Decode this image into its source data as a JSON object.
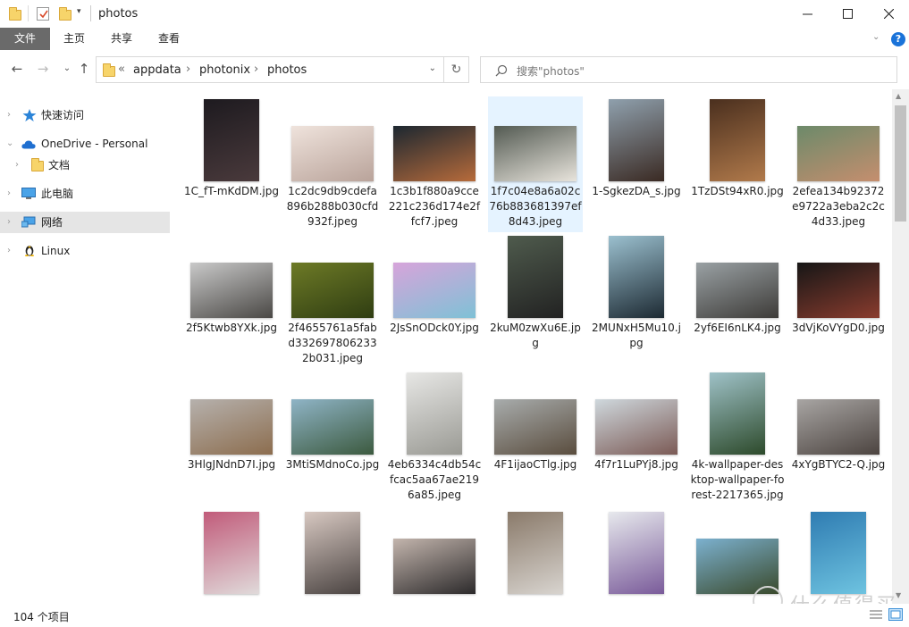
{
  "window": {
    "title": "photos"
  },
  "ribbon": {
    "tabs": [
      "文件",
      "主页",
      "共享",
      "查看"
    ]
  },
  "address": {
    "overflow": "«",
    "parts": [
      "appdata",
      "photonix",
      "photos"
    ],
    "separator": "›"
  },
  "search": {
    "placeholder": "搜索\"photos\""
  },
  "sidebar": {
    "items": [
      {
        "label": "快速访问",
        "icon": "star-icon"
      },
      {
        "label": "OneDrive - Personal",
        "icon": "cloud-icon"
      },
      {
        "label": "文档",
        "icon": "folder-icon"
      },
      {
        "label": "此电脑",
        "icon": "computer-icon"
      },
      {
        "label": "网络",
        "icon": "network-icon"
      },
      {
        "label": "Linux",
        "icon": "linux-icon"
      }
    ]
  },
  "files": [
    {
      "name": "1C_fT-mKdDM.jpg",
      "c1": "#1d1a1f",
      "c2": "#4a3a3c"
    },
    {
      "name": "1c2dc9db9cdefa896b288b030cfd932f.jpeg",
      "c1": "#efe3dc",
      "c2": "#b9a39a"
    },
    {
      "name": "1c3b1f880a9cce221c236d174e2ffcf7.jpeg",
      "c1": "#1c2730",
      "c2": "#b76b3b"
    },
    {
      "name": "1f7c04e8a6a02c76b883681397ef8d43.jpeg",
      "c1": "#535a52",
      "c2": "#e8e4dc"
    },
    {
      "name": "1-SgkezDA_s.jpg",
      "c1": "#8fa0ad",
      "c2": "#3a2a23"
    },
    {
      "name": "1TzDSt94xR0.jpg",
      "c1": "#4a2f1e",
      "c2": "#b17a4b"
    },
    {
      "name": "2efea134b92372e9722a3eba2c2c4d33.jpeg",
      "c1": "#6c8a6a",
      "c2": "#c58e6e"
    },
    {
      "name": "2f5Ktwb8YXk.jpg",
      "c1": "#c9c9c9",
      "c2": "#4a4845"
    },
    {
      "name": "2f4655761a5fabd3326978062332b031.jpeg",
      "c1": "#6d7a26",
      "c2": "#2f3d12"
    },
    {
      "name": "2JsSnODck0Y.jpg",
      "c1": "#d7a4da",
      "c2": "#7fc1d6"
    },
    {
      "name": "2kuM0zwXu6E.jpg",
      "c1": "#4f5b4d",
      "c2": "#222"
    },
    {
      "name": "2MUNxH5Mu10.jpg",
      "c1": "#9bc0cf",
      "c2": "#1d2a33"
    },
    {
      "name": "2yf6EI6nLK4.jpg",
      "c1": "#9aa1a4",
      "c2": "#3d3b38"
    },
    {
      "name": "3dVjKoVYgD0.jpg",
      "c1": "#161616",
      "c2": "#8a3c2e"
    },
    {
      "name": "3HlgJNdnD7I.jpg",
      "c1": "#b6b1ad",
      "c2": "#8c6d4e"
    },
    {
      "name": "3MtiSMdnoCo.jpg",
      "c1": "#8fb4c6",
      "c2": "#3c5a3f"
    },
    {
      "name": "4eb6334c4db54cfcac5aa67ae2196a85.jpeg",
      "c1": "#e7e7e5",
      "c2": "#9a9a94"
    },
    {
      "name": "4F1ijaoCTlg.jpg",
      "c1": "#a8acac",
      "c2": "#5a4d3e"
    },
    {
      "name": "4f7r1LuPYj8.jpg",
      "c1": "#cfd8dd",
      "c2": "#7b5a55"
    },
    {
      "name": "4k-wallpaper-desktop-wallpaper-forest-2217365.jpg",
      "c1": "#9fc2c8",
      "c2": "#2d4a2b"
    },
    {
      "name": "4xYgBTYC2-Q.jpg",
      "c1": "#a8a5a3",
      "c2": "#4c4440"
    },
    {
      "name": "",
      "c1": "#c15b7a",
      "c2": "#e0dada"
    },
    {
      "name": "",
      "c1": "#d7c8c1",
      "c2": "#4b4442"
    },
    {
      "name": "",
      "c1": "#c3b5ad",
      "c2": "#2c2a2b"
    },
    {
      "name": "",
      "c1": "#8a7a6a",
      "c2": "#d8d4cf"
    },
    {
      "name": "",
      "c1": "#e7e9ed",
      "c2": "#7a5b9a"
    },
    {
      "name": "",
      "c1": "#7cb1cf",
      "c2": "#3a4a2c"
    },
    {
      "name": "",
      "c1": "#2f7cb2",
      "c2": "#6ec3e0"
    }
  ],
  "status": {
    "item_count": "104 个项目"
  },
  "watermark": "什么值得买",
  "colors": {
    "file_tab": "#6a6a6a",
    "selection": "#e5f3ff",
    "accent": "#1a73d9"
  }
}
